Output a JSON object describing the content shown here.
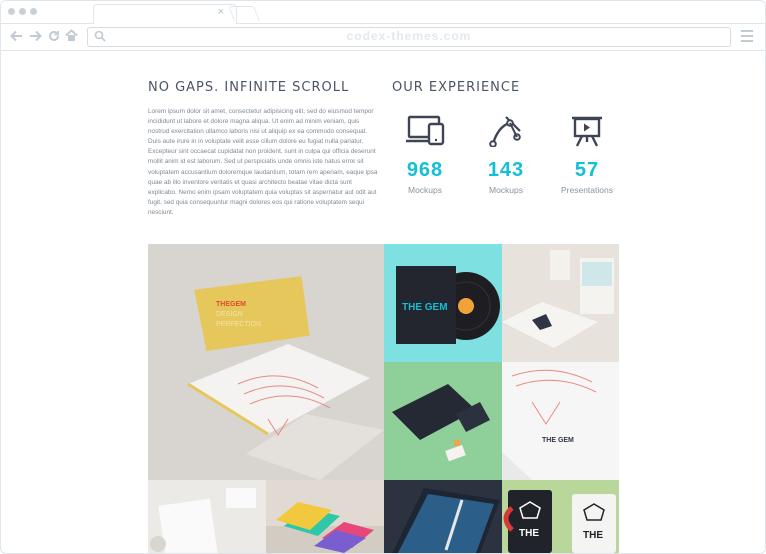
{
  "browser": {
    "url": "codex-themes.com",
    "tab_close": "×"
  },
  "icons": {
    "back": "arrow-left-icon",
    "forward": "arrow-right-icon",
    "reload": "reload-icon",
    "home": "home-icon",
    "search": "search-icon",
    "menu": "hamburger-menu-icon"
  },
  "left": {
    "heading": "NO GAPS. INFINITE SCROLL",
    "paragraph": "Lorem ipsum dolor sit amet, consectetur adipisicing elit, sed do eiusmod tempor incididunt ut labore et dolore magna aliqua. Ut enim ad minim veniam, quis nostrud exercitation ullamco laboris nisi ut aliquip ex ea commodo consequat. Duis aute irure in in voluptate velit esse cillum dolore eu fugiat nulla pariatur. Excepteur sint occaecat cupidatat non proident, sunt in culpa qui officia deserunt mollit anim id est laborum. Sed ut perspiciatis unde omnis iste natus error sit voluptatem accusantium doloremque laudantium, totam rem aperiam, eaque ipsa quae ab illo inventore veritatis et quasi architecto beatae vitae dicta sunt explicabo. Nemo enim ipsam voluptatem quia voluptas sit aspernatur aut odit aut fugit, sed quia consequuntur magni dolores eos qui ratione voluptatem sequi nesciunt."
  },
  "right": {
    "heading": "OUR EXPERIENCE",
    "stats": [
      {
        "value": "968",
        "label": "Mockups",
        "icon": "devices-icon"
      },
      {
        "value": "143",
        "label": "Mockups",
        "icon": "vector-pen-icon"
      },
      {
        "value": "57",
        "label": "Presentations",
        "icon": "presentation-board-icon"
      }
    ]
  },
  "gallery": {
    "brand_text": "THE GEM",
    "book_lines": [
      "THEGEM",
      "DESIGN",
      "PERFECTION"
    ],
    "mug_label": "THE",
    "accent": "#12bfd4",
    "tiles": [
      {
        "name": "gallery-tile-book-mockup",
        "bg": "#d8d5d0"
      },
      {
        "name": "gallery-tile-vinyl-mockup",
        "bg": "#7fe0e1"
      },
      {
        "name": "gallery-tile-books-stack",
        "bg": "#e7e3dc"
      },
      {
        "name": "gallery-tile-stationery-green",
        "bg": "#8fcf99"
      },
      {
        "name": "gallery-tile-paper-mockup",
        "bg": "#e9e9ea"
      },
      {
        "name": "gallery-tile-letterhead",
        "bg": "#eceae6"
      },
      {
        "name": "gallery-tile-business-cards",
        "bg": "#e0dad2"
      },
      {
        "name": "gallery-tile-tablet",
        "bg": "#2c3340"
      },
      {
        "name": "gallery-tile-mugs",
        "bg": "#b9d79a"
      }
    ]
  }
}
